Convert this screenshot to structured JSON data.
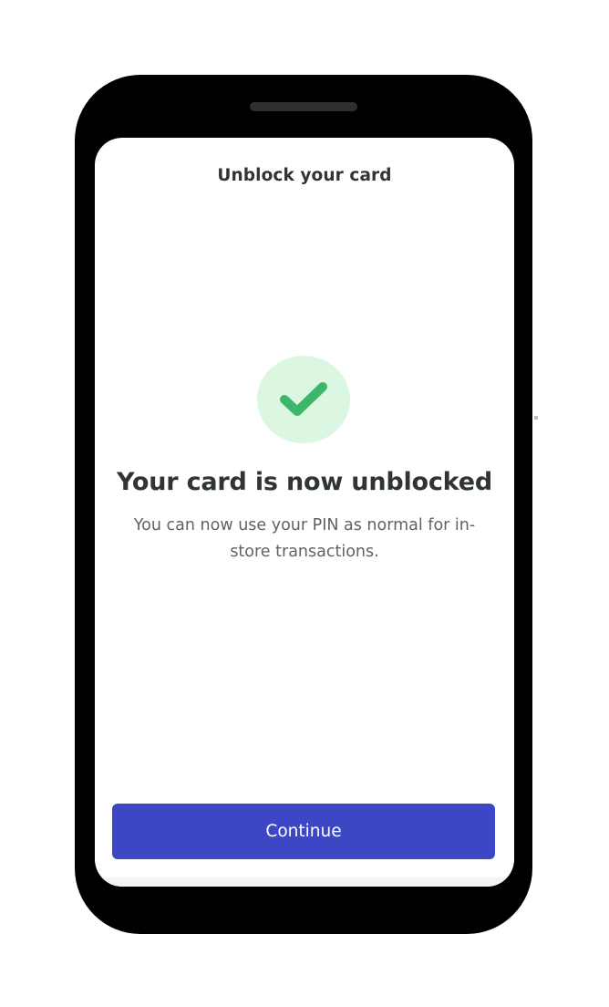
{
  "screen": {
    "header_title": "Unblock your card",
    "status_icon": "check-icon",
    "headline": "Your card is now unblocked",
    "body": "You can now use your PIN as normal for in-store transactions.",
    "continue_label": "Continue"
  },
  "colors": {
    "device_frame": "#000000",
    "screen_background": "#ffffff",
    "success_circle": "#dcf7e1",
    "success_check": "#3cb668",
    "primary_button": "#3c47c6",
    "primary_button_text": "#ffffff",
    "heading_text": "#2f3437",
    "body_text": "#5d636a"
  }
}
